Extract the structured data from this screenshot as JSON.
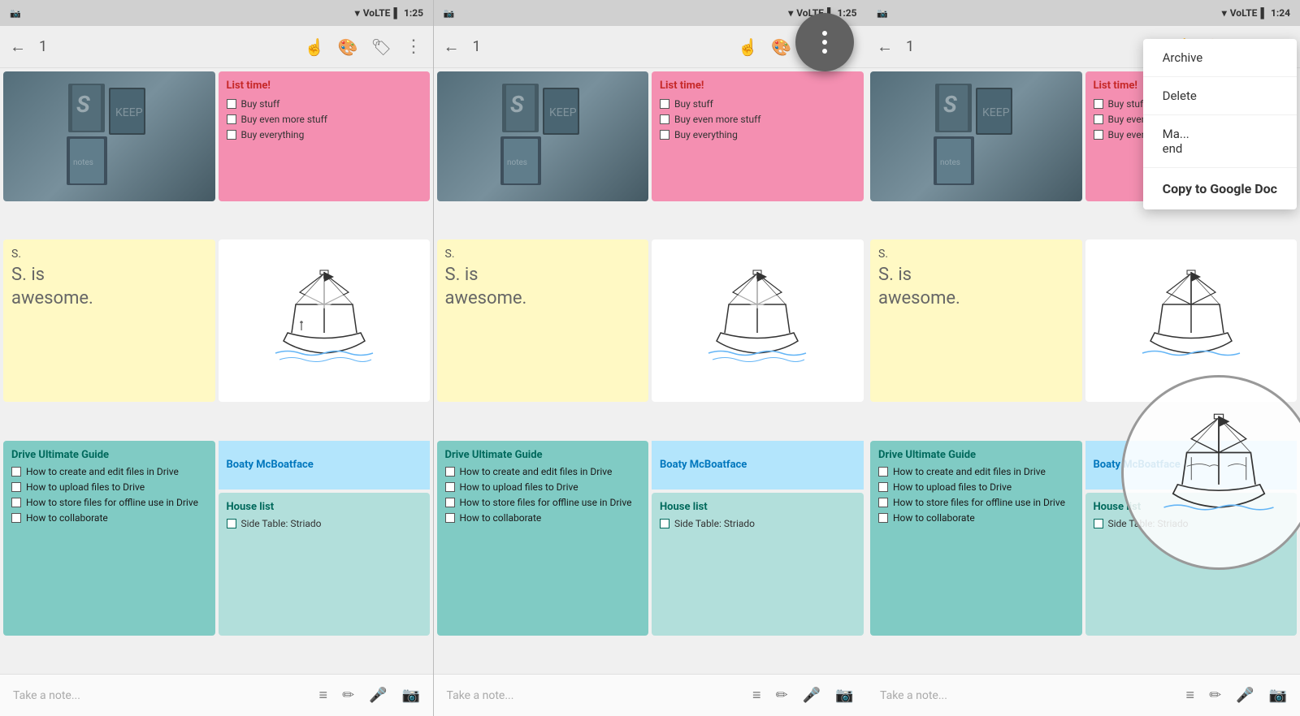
{
  "panels": [
    {
      "id": "panel1",
      "status": {
        "left": "📷",
        "signal": "▾",
        "lte": "VoLTE",
        "bars": "▂▄▆",
        "battery": "🔋",
        "time": "1:25"
      },
      "toolbar": {
        "back": "←",
        "num": "1",
        "icon1": "✋",
        "icon2": "🎨",
        "icon3": "🏷",
        "more": "⋮"
      },
      "notes": {
        "pink": {
          "title": "List time!",
          "items": [
            "Buy stuff",
            "Buy even more stuff",
            "Buy everything"
          ]
        },
        "yellow": {
          "title": "S.",
          "body": "S. is\nawesome."
        },
        "blue": {
          "title": "Drive Ultimate Guide",
          "items": [
            "How to create and edit files in Drive",
            "How to upload files to Drive",
            "How to store files for offline use in Drive",
            "How to collaborate"
          ]
        },
        "boaty": {
          "title": "Boaty McBoatface"
        },
        "houselist": {
          "title": "House list",
          "items": [
            "Side Table: Striado"
          ]
        }
      },
      "bottom": {
        "placeholder": "Take a note...",
        "icons": [
          "≡",
          "✏",
          "🎤",
          "📷"
        ]
      }
    },
    {
      "id": "panel2",
      "status": {
        "time": "1:25"
      },
      "fab": {
        "visible": true
      }
    },
    {
      "id": "panel3",
      "status": {
        "time": "1:24"
      },
      "dropdown": {
        "items": [
          "Archive",
          "Delete",
          "Ma...end",
          "Copy to Google Doc"
        ]
      }
    }
  ],
  "ship_note_alt": "Hand-drawn sailing ship illustration"
}
